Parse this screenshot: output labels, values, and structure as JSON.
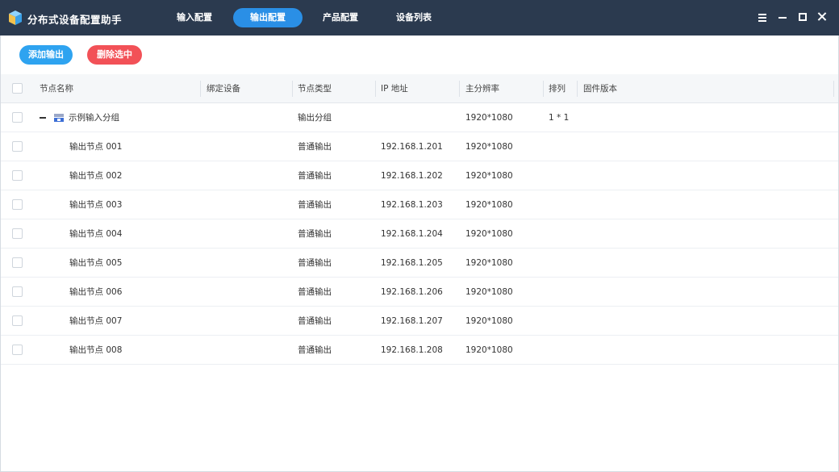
{
  "app": {
    "title": "分布式设备配置助手"
  },
  "nav": {
    "tabs": [
      {
        "label": "输入配置",
        "active": false
      },
      {
        "label": "输出配置",
        "active": true
      },
      {
        "label": "产品配置",
        "active": false
      },
      {
        "label": "设备列表",
        "active": false
      }
    ]
  },
  "window_controls": [
    "menu-icon",
    "minimize-icon",
    "maximize-icon",
    "close-icon"
  ],
  "toolbar": {
    "add_label": "添加输出",
    "delete_label": "删除选中"
  },
  "colors": {
    "titlebar": "#2b3a4f",
    "accent": "#2a8fe6",
    "add": "#2ea3f0",
    "delete": "#f25157"
  },
  "table": {
    "headers": {
      "name": "节点名称",
      "bind": "绑定设备",
      "type": "节点类型",
      "ip": "IP 地址",
      "resolution": "主分辨率",
      "arrangement": "排列",
      "firmware": "固件版本"
    },
    "group": {
      "name": "示例输入分组",
      "type": "输出分组",
      "resolution": "1920*1080",
      "arrangement": "1 * 1",
      "icon": "group-icon"
    },
    "rows": [
      {
        "name": "输出节点 001",
        "type": "普通输出",
        "ip": "192.168.1.201",
        "resolution": "1920*1080"
      },
      {
        "name": "输出节点 002",
        "type": "普通输出",
        "ip": "192.168.1.202",
        "resolution": "1920*1080"
      },
      {
        "name": "输出节点 003",
        "type": "普通输出",
        "ip": "192.168.1.203",
        "resolution": "1920*1080"
      },
      {
        "name": "输出节点 004",
        "type": "普通输出",
        "ip": "192.168.1.204",
        "resolution": "1920*1080"
      },
      {
        "name": "输出节点 005",
        "type": "普通输出",
        "ip": "192.168.1.205",
        "resolution": "1920*1080"
      },
      {
        "name": "输出节点 006",
        "type": "普通输出",
        "ip": "192.168.1.206",
        "resolution": "1920*1080"
      },
      {
        "name": "输出节点 007",
        "type": "普通输出",
        "ip": "192.168.1.207",
        "resolution": "1920*1080"
      },
      {
        "name": "输出节点 008",
        "type": "普通输出",
        "ip": "192.168.1.208",
        "resolution": "1920*1080"
      }
    ]
  }
}
